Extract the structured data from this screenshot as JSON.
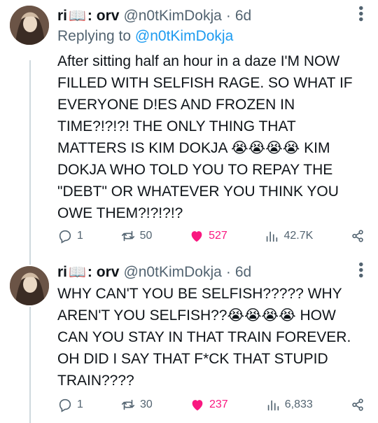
{
  "tweets": [
    {
      "user": {
        "name_prefix": "ri",
        "name_suffix": ": orv",
        "book_emoji": "📖",
        "handle": "@n0tKimDokja",
        "time": "6d"
      },
      "reply_label": "Replying to",
      "reply_handle": "@n0tKimDokja",
      "text": "After sitting half an hour in a daze I'M NOW FILLED WITH SELFISH RAGE. SO WHAT IF EVERYONE D!ES AND FROZEN IN TIME?!?!?! THE ONLY THING THAT MATTERS IS KIM DOKJA 😭😭😭😭 KIM DOKJA WHO TOLD YOU TO REPAY THE \"DEBT\" OR WHATEVER YOU THINK YOU OWE THEM?!?!?!?",
      "stats": {
        "replies": "1",
        "retweets": "50",
        "likes": "527",
        "views": "42.7K"
      }
    },
    {
      "user": {
        "name_prefix": "ri",
        "name_suffix": ": orv",
        "book_emoji": "📖",
        "handle": "@n0tKimDokja",
        "time": "6d"
      },
      "text": "WHY CAN'T YOU BE SELFISH????? WHY AREN'T YOU SELFISH??😭😭😭😭 HOW CAN YOU STAY IN THAT TRAIN FOREVER. OH DID I SAY THAT F*CK THAT STUPID TRAIN????",
      "stats": {
        "replies": "1",
        "retweets": "30",
        "likes": "237",
        "views": "6,833"
      }
    }
  ],
  "colors": {
    "text": "#0f1419",
    "muted": "#536471",
    "link": "#1d9bf0",
    "like": "#f91880",
    "thread_line": "#cfd9de"
  },
  "icons": {
    "reply": "speech-bubble-icon",
    "retweet": "retweet-icon",
    "like": "heart-icon",
    "views": "bar-chart-icon",
    "share": "share-icon",
    "more": "more-dots-icon"
  }
}
